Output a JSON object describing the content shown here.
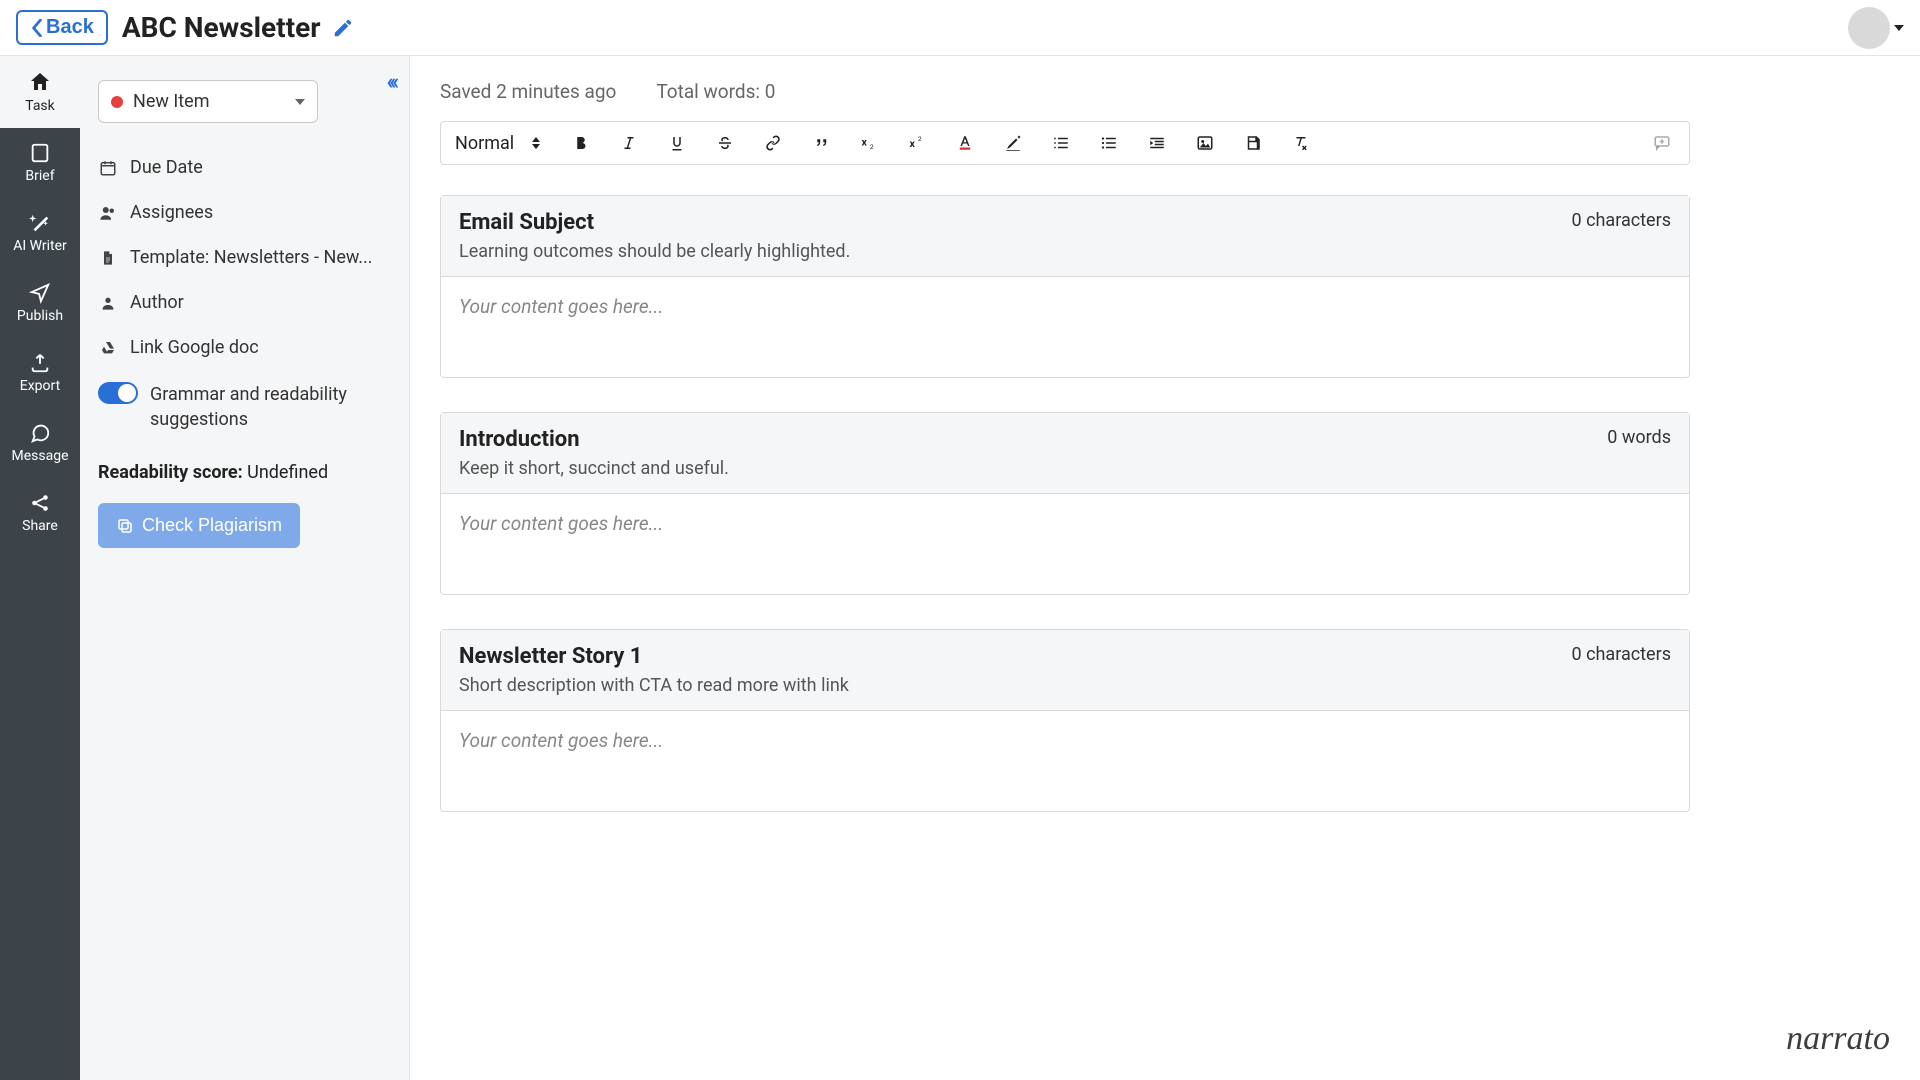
{
  "header": {
    "back_label": "Back",
    "title": "ABC Newsletter"
  },
  "rail": [
    {
      "key": "task",
      "label": "Task"
    },
    {
      "key": "brief",
      "label": "Brief"
    },
    {
      "key": "ai-writer",
      "label": "AI Writer"
    },
    {
      "key": "publish",
      "label": "Publish"
    },
    {
      "key": "export",
      "label": "Export"
    },
    {
      "key": "message",
      "label": "Message"
    },
    {
      "key": "share",
      "label": "Share"
    }
  ],
  "sidepanel": {
    "status_selected": "New Item",
    "meta": {
      "due_date": "Due Date",
      "assignees": "Assignees",
      "template": "Template: Newsletters - New...",
      "author": "Author",
      "gdoc": "Link Google doc",
      "grammar_toggle": "Grammar and readability suggestions"
    },
    "readability_label": "Readability score:",
    "readability_value": "Undefined",
    "check_plagiarism": "Check Plagiarism"
  },
  "main": {
    "saved": "Saved 2 minutes ago",
    "total_words": "Total words: 0",
    "toolbar_format": "Normal",
    "sections": [
      {
        "title": "Email Subject",
        "sub": "Learning outcomes should be clearly highlighted.",
        "count": "0 characters",
        "placeholder": "Your content goes here..."
      },
      {
        "title": "Introduction",
        "sub": "Keep it short, succinct and useful.",
        "count": "0 words",
        "placeholder": "Your content goes here..."
      },
      {
        "title": "Newsletter Story 1",
        "sub": "Short description with CTA to read more with link",
        "count": "0 characters",
        "placeholder": "Your content goes here..."
      }
    ]
  },
  "brand": "narrato"
}
